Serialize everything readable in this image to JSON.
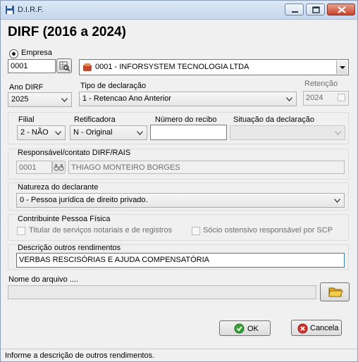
{
  "window": {
    "title": "D.I.R.F."
  },
  "header": {
    "title": "DIRF (2016 a 2024)"
  },
  "empresa": {
    "label": "Empresa",
    "code": "0001",
    "company_name": "0001 - INFORSYSTEM TECNOLOGIA LTDA"
  },
  "ano_dirf": {
    "label": "Ano DIRF",
    "value": "2025"
  },
  "tipo_declaracao": {
    "label": "Tipo de declaração",
    "value": "1 - Retencao Ano Anterior"
  },
  "retencao": {
    "label": "Retenção",
    "value": "2024"
  },
  "filial": {
    "label": "Filial",
    "value": "2 - NÃO"
  },
  "retificadora": {
    "label": "Retificadora",
    "value": "N - Original"
  },
  "numero_recibo": {
    "label": "Número do recibo",
    "value": ""
  },
  "situacao": {
    "label": "Situação da declaração",
    "value": ""
  },
  "responsavel": {
    "label": "Responsável/contato DIRF/RAIS",
    "code": "0001",
    "name": "THIAGO MONTEIRO BORGES"
  },
  "natureza": {
    "label": "Natureza do declarante",
    "value": "0 - Pessoa jurídica de direito privado."
  },
  "contribuinte": {
    "label": "Contribuinte Pessoa Física",
    "titular_label": "Titular de serviços notariais e de registros",
    "socio_label": "Sócio ostensivo responsável por SCP"
  },
  "descricao": {
    "label": "Descrição outros rendimentos",
    "value": "VERBAS RESCISÓRIAS E AJUDA COMPENSATÓRIA"
  },
  "arquivo": {
    "label": "Nome do arquivo ....",
    "value": ""
  },
  "buttons": {
    "ok": "OK",
    "cancel": "Cancela"
  },
  "status": {
    "text": "Informe a descrição de outros rendimentos."
  },
  "colors": {
    "ok_icon": "#3aa33a",
    "cancel_icon": "#d9342b",
    "active_border": "#3d7bad",
    "title_bar": "#c6d8ee"
  }
}
